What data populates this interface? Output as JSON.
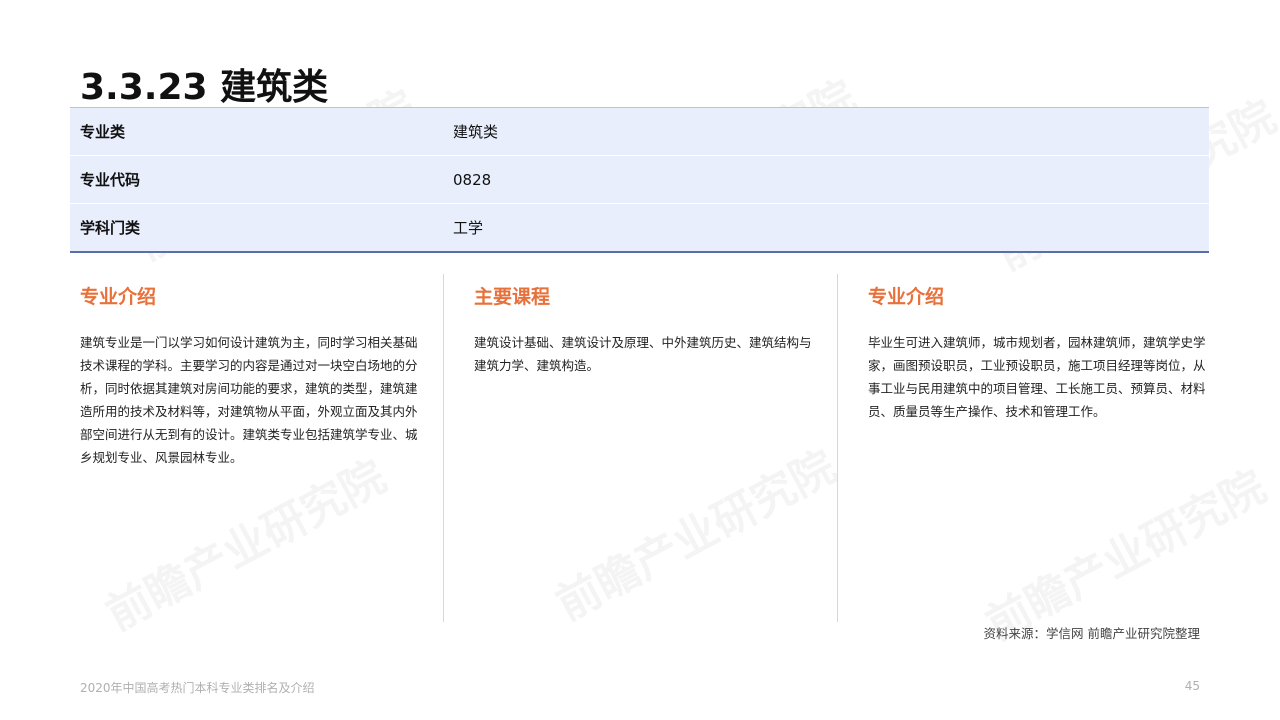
{
  "title": "3.3.23 建筑类",
  "info_table": [
    {
      "label": "专业类",
      "value": "建筑类"
    },
    {
      "label": "专业代码",
      "value": "0828"
    },
    {
      "label": "学科门类",
      "value": "工学"
    }
  ],
  "columns": [
    {
      "heading": "专业介绍",
      "body": "建筑专业是一门以学习如何设计建筑为主，同时学习相关基础技术课程的学科。主要学习的内容是通过对一块空白场地的分析，同时依据其建筑对房间功能的要求，建筑的类型，建筑建造所用的技术及材料等，对建筑物从平面，外观立面及其内外部空间进行从无到有的设计。建筑类专业包括建筑学专业、城乡规划专业、风景园林专业。"
    },
    {
      "heading": "主要课程",
      "body": "建筑设计基础、建筑设计及原理、中外建筑历史、建筑结构与建筑力学、建筑构造。"
    },
    {
      "heading": "专业介绍",
      "body": "毕业生可进入建筑师，城市规划者，园林建筑师，建筑学史学家，画图预设职员，工业预设职员，施工项目经理等岗位，从事工业与民用建筑中的项目管理、工长施工员、预算员、材料员、质量员等生产操作、技术和管理工作。"
    }
  ],
  "source": "资料来源：学信网 前瞻产业研究院整理",
  "footer": {
    "left": "2020年中国高考热门本科专业类排名及介绍",
    "page_number": "45"
  },
  "watermark_text": "前瞻产业研究院"
}
